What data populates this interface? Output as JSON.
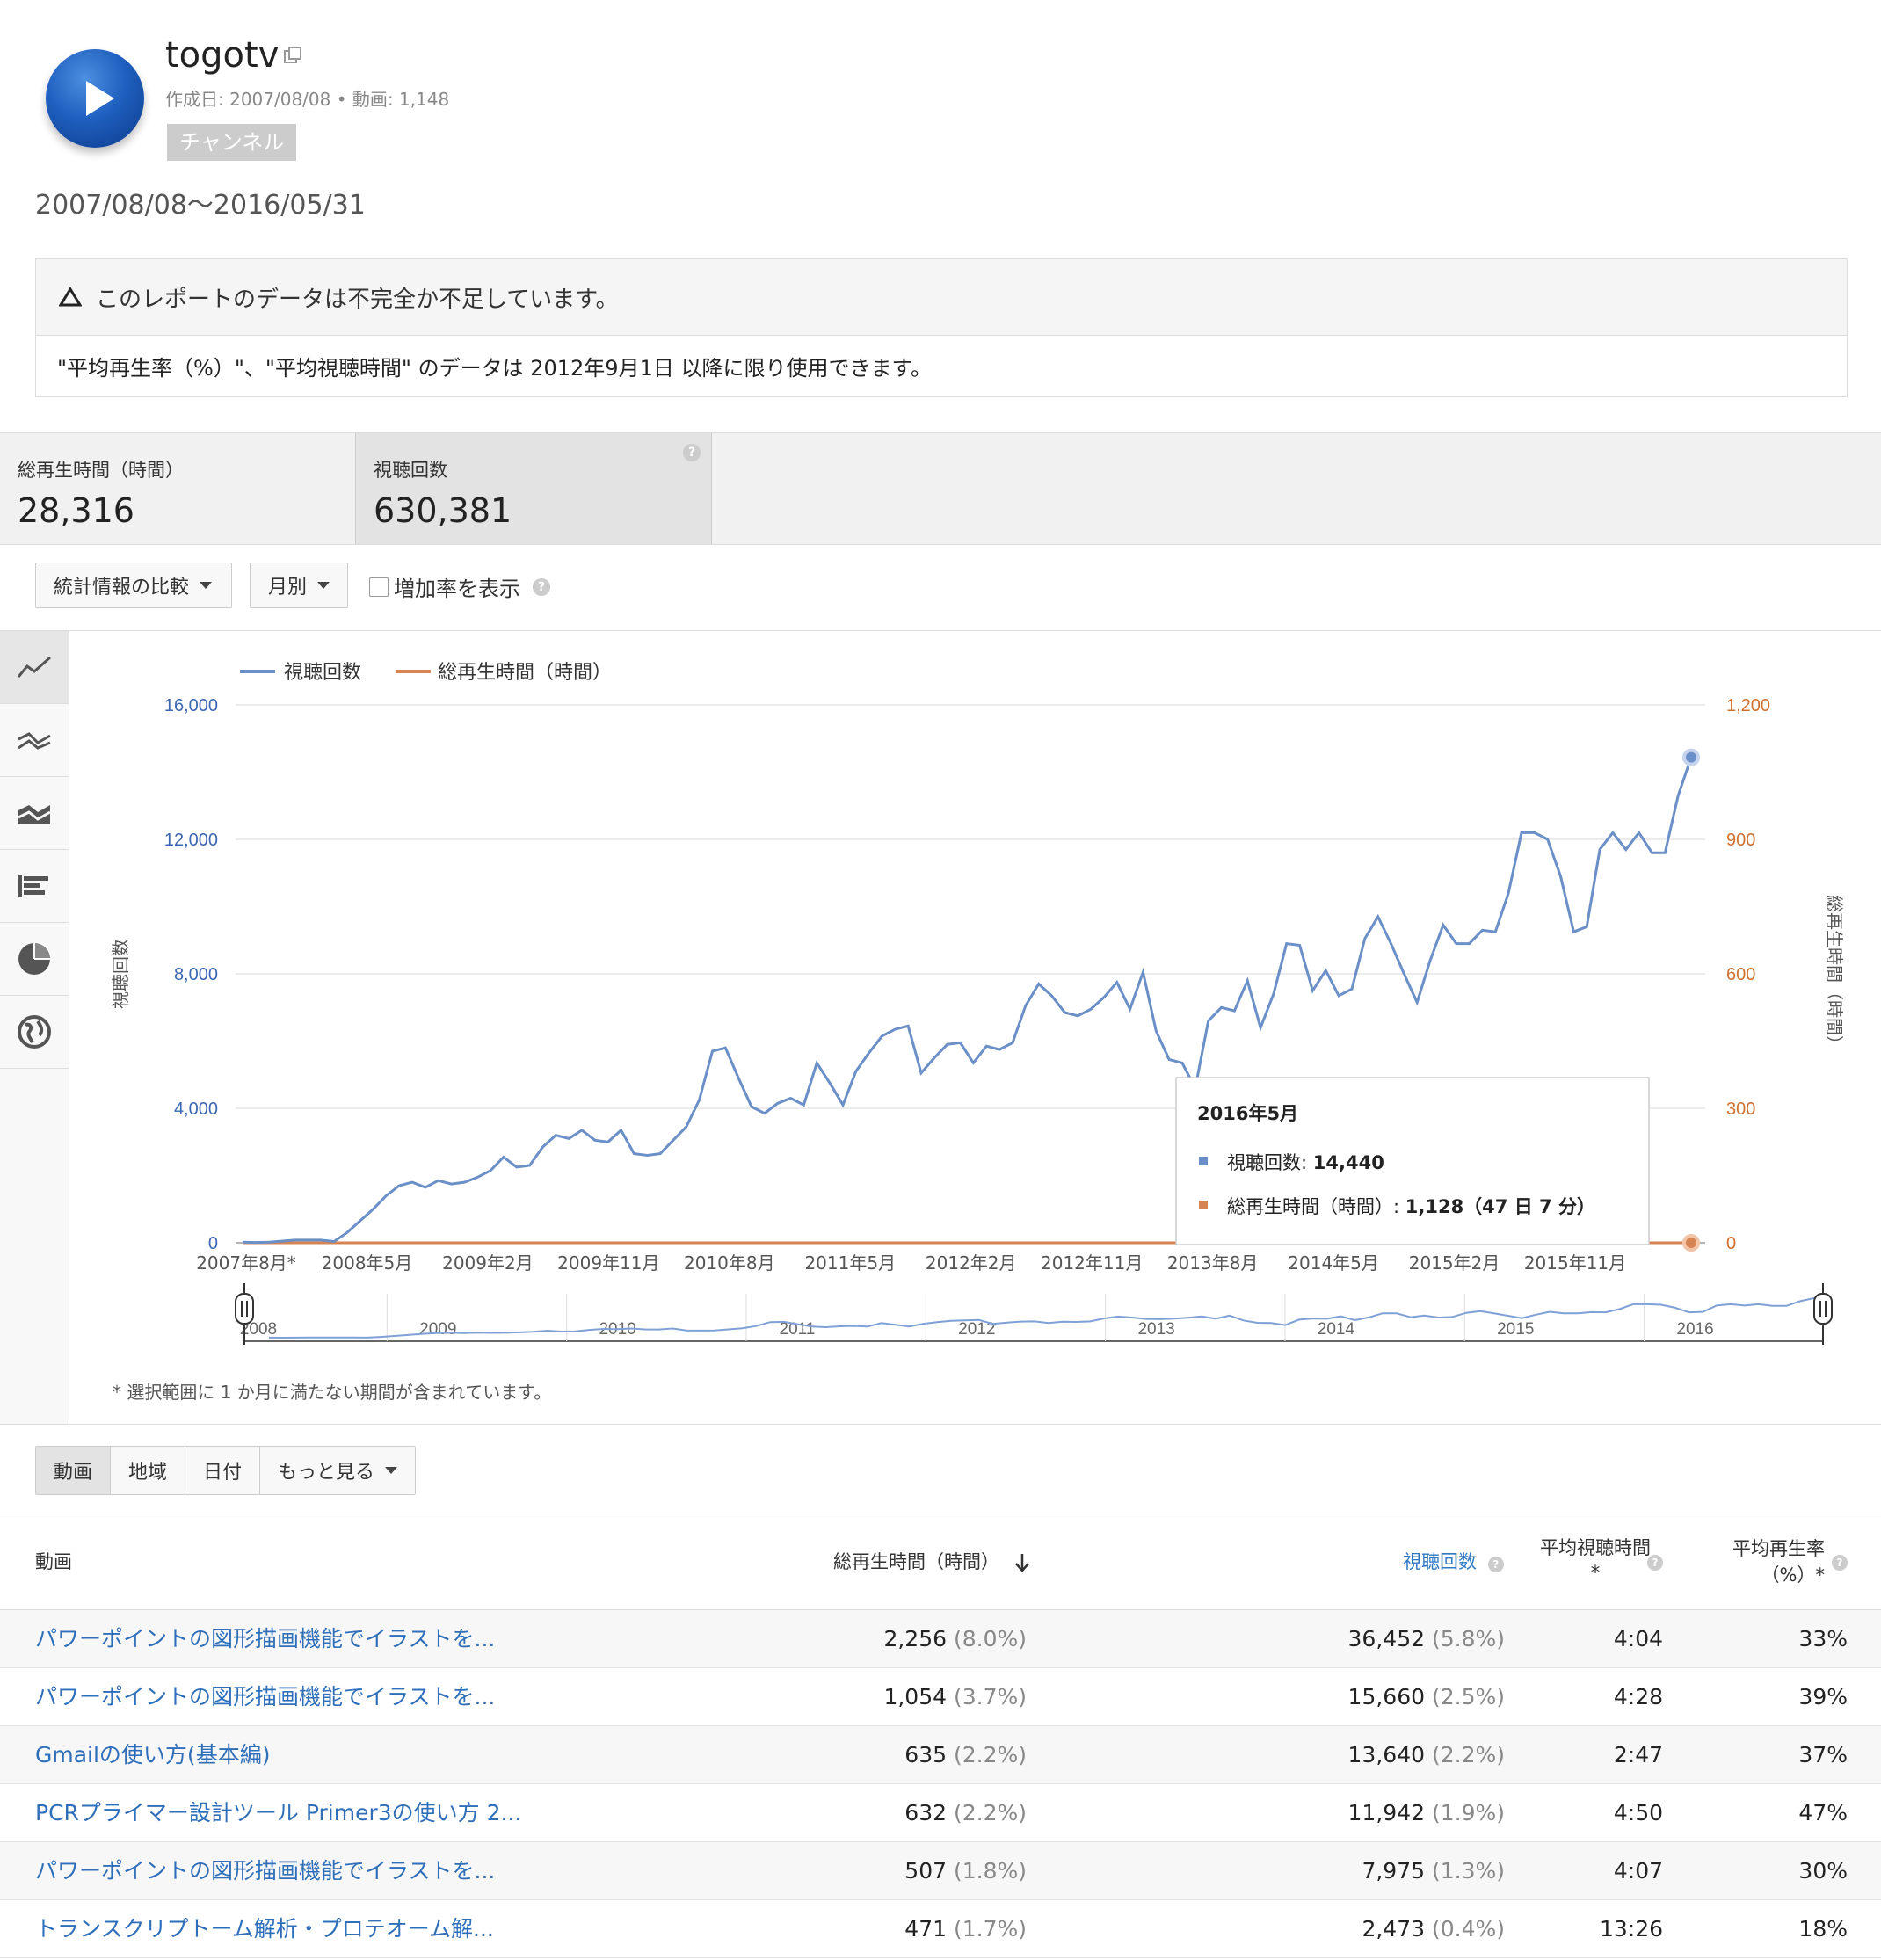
{
  "channel": {
    "name": "togotv",
    "meta": "作成日: 2007/08/08 • 動画: 1,148",
    "badge": "チャンネル"
  },
  "date_range": "2007/08/08〜2016/05/31",
  "warning": {
    "title": "このレポートのデータは不完全か不足しています。",
    "body": "\"平均再生率（%）\"、\"平均視聴時間\" のデータは 2012年9月1日 以降に限り使用できます。"
  },
  "metrics": [
    {
      "label": "総再生時間（時間）",
      "value": "28,316"
    },
    {
      "label": "視聴回数",
      "value": "630,381"
    }
  ],
  "controls": {
    "compare_label": "統計情報の比較",
    "period_label": "月別",
    "growth_label": "増加率を表示"
  },
  "chart_data": {
    "type": "line",
    "legend": [
      {
        "name": "視聴回数",
        "color": "#6b8fc7"
      },
      {
        "name": "総再生時間（時間）",
        "color": "#d68453"
      }
    ],
    "x_ticks": [
      "2007年8月*",
      "2008年5月",
      "2009年2月",
      "2009年11月",
      "2010年8月",
      "2011年5月",
      "2012年2月",
      "2012年11月",
      "2013年8月",
      "2014年5月",
      "2015年2月",
      "2015年11月"
    ],
    "y_left": {
      "label": "視聴回数",
      "ticks": [
        "16,000",
        "12,000",
        "8,000",
        "4,000",
        "0"
      ],
      "ylim": [
        0,
        16000
      ]
    },
    "y_right": {
      "label": "総再生時間（時間）",
      "ticks": [
        "1,200",
        "900",
        "600",
        "300",
        "0"
      ],
      "ylim": [
        0,
        1200
      ]
    },
    "months_start": "2007-08",
    "series": [
      {
        "name": "視聴回数",
        "color": "#6b8fc7",
        "values": [
          20,
          10,
          20,
          50,
          80,
          80,
          80,
          40,
          300,
          650,
          1000,
          1400,
          1700,
          1800,
          1650,
          1850,
          1750,
          1800,
          1950,
          2150,
          2550,
          2250,
          2300,
          2850,
          3200,
          3100,
          3350,
          3050,
          3000,
          3350,
          2650,
          2600,
          2650,
          3050,
          3450,
          4250,
          5700,
          5800,
          4900,
          4050,
          3850,
          4150,
          4300,
          4100,
          5350,
          4750,
          4100,
          5100,
          5650,
          6150,
          6350,
          6450,
          5050,
          5500,
          5900,
          5950,
          5350,
          5850,
          5750,
          5950,
          7050,
          7700,
          7350,
          6850,
          6750,
          6950,
          7300,
          7750,
          6950,
          8050,
          6300,
          5450,
          5350,
          4600,
          6600,
          7000,
          6900,
          7800,
          6400,
          7400,
          8900,
          8850,
          7500,
          8100,
          7350,
          7550,
          9050,
          9700,
          8900,
          8000,
          7150,
          8400,
          9450,
          8900,
          8900,
          9300,
          9250,
          10400,
          12200,
          12200,
          12000,
          10900,
          9250,
          9400,
          11700,
          12200,
          11700,
          12200,
          11600,
          11600,
          13300,
          14440
        ]
      },
      {
        "name": "総再生時間（時間）",
        "color": "#d68453",
        "values": [
          0,
          0,
          0,
          0,
          0,
          0,
          0,
          0,
          0,
          0,
          0,
          0,
          0,
          0,
          0,
          0,
          0,
          0,
          0,
          0,
          0,
          0,
          0,
          0,
          0,
          0,
          0,
          0,
          0,
          0,
          0,
          0,
          0,
          0,
          0,
          0,
          0,
          0,
          0,
          0,
          0,
          0,
          0,
          0,
          0,
          0,
          0,
          0,
          0,
          0,
          0,
          0,
          0,
          0,
          0,
          0,
          0,
          0,
          0,
          0,
          0,
          0,
          0,
          0,
          0,
          0,
          0,
          0,
          0,
          0,
          0,
          0,
          0,
          0,
          0,
          0,
          0,
          0,
          0,
          0,
          0,
          0,
          0,
          0,
          0,
          0,
          0,
          0,
          0,
          0,
          0,
          0,
          0,
          0,
          0,
          0,
          0,
          0,
          0,
          0,
          0,
          0,
          0,
          0,
          0,
          0,
          0,
          0,
          0,
          0,
          0,
          0
        ]
      }
    ],
    "tooltip": {
      "title": "2016年5月",
      "rows": [
        {
          "label": "視聴回数: ",
          "value": "14,440",
          "color": "#6b8fc7"
        },
        {
          "label": "総再生時間（時間）: ",
          "value": "1,128（47 日 7 分）",
          "color": "#d68453"
        }
      ]
    },
    "overview_years": [
      "2008",
      "2009",
      "2010",
      "2011",
      "2012",
      "2013",
      "2014",
      "2015",
      "2016"
    ]
  },
  "watch_hours_values": [
    0,
    0,
    0,
    0,
    0,
    0,
    0,
    0,
    0,
    0,
    0,
    0,
    0,
    0,
    0,
    0,
    0,
    0,
    0,
    0,
    0,
    0,
    0,
    0,
    0,
    0,
    0,
    0,
    0,
    0,
    0,
    0,
    0,
    0,
    0,
    0,
    0,
    0,
    0,
    0,
    0,
    0,
    0,
    0,
    0,
    0,
    0,
    0,
    0,
    0,
    0,
    0,
    0,
    0,
    0,
    0,
    0,
    0,
    0,
    0,
    0,
    0,
    0,
    0,
    0,
    0,
    0,
    0,
    0,
    0,
    0,
    0,
    0,
    0,
    0,
    0,
    0,
    0,
    0,
    0,
    0,
    0,
    0,
    0,
    0,
    0,
    0,
    0,
    0,
    0,
    0,
    0,
    0,
    0,
    0,
    0,
    0,
    0,
    0,
    0,
    0,
    0,
    0,
    0,
    0,
    0,
    0,
    0,
    0,
    0,
    0,
    0
  ],
  "footnote": "* 選択範囲に 1 か月に満たない期間が含まれています。",
  "tabs": [
    "動画",
    "地域",
    "日付",
    "もっと見る"
  ],
  "table": {
    "headers": {
      "video": "動画",
      "watch_time": "総再生時間（時間）",
      "views": "視聴回数",
      "avg_duration": "平均視聴時間",
      "avg_duration_star": "*",
      "avg_pct_line1": "平均再生率",
      "avg_pct_line2": "（%）*"
    },
    "rows": [
      {
        "title": "パワーポイントの図形描画機能でイラストを...",
        "watch": "2,256",
        "watch_pct": "(8.0%)",
        "views": "36,452",
        "views_pct": "(5.8%)",
        "avg": "4:04",
        "rate": "33%"
      },
      {
        "title": "パワーポイントの図形描画機能でイラストを...",
        "watch": "1,054",
        "watch_pct": "(3.7%)",
        "views": "15,660",
        "views_pct": "(2.5%)",
        "avg": "4:28",
        "rate": "39%"
      },
      {
        "title": "Gmailの使い方(基本編)",
        "watch": "635",
        "watch_pct": "(2.2%)",
        "views": "13,640",
        "views_pct": "(2.2%)",
        "avg": "2:47",
        "rate": "37%"
      },
      {
        "title": "PCRプライマー設計ツール Primer3の使い方 2...",
        "watch": "632",
        "watch_pct": "(2.2%)",
        "views": "11,942",
        "views_pct": "(1.9%)",
        "avg": "4:50",
        "rate": "47%"
      },
      {
        "title": "パワーポイントの図形描画機能でイラストを...",
        "watch": "507",
        "watch_pct": "(1.8%)",
        "views": "7,975",
        "views_pct": "(1.3%)",
        "avg": "4:07",
        "rate": "30%"
      },
      {
        "title": "トランスクリプトーム解析・プロテオーム解...",
        "watch": "471",
        "watch_pct": "(1.7%)",
        "views": "2,473",
        "views_pct": "(0.4%)",
        "avg": "13:26",
        "rate": "18%"
      }
    ]
  }
}
